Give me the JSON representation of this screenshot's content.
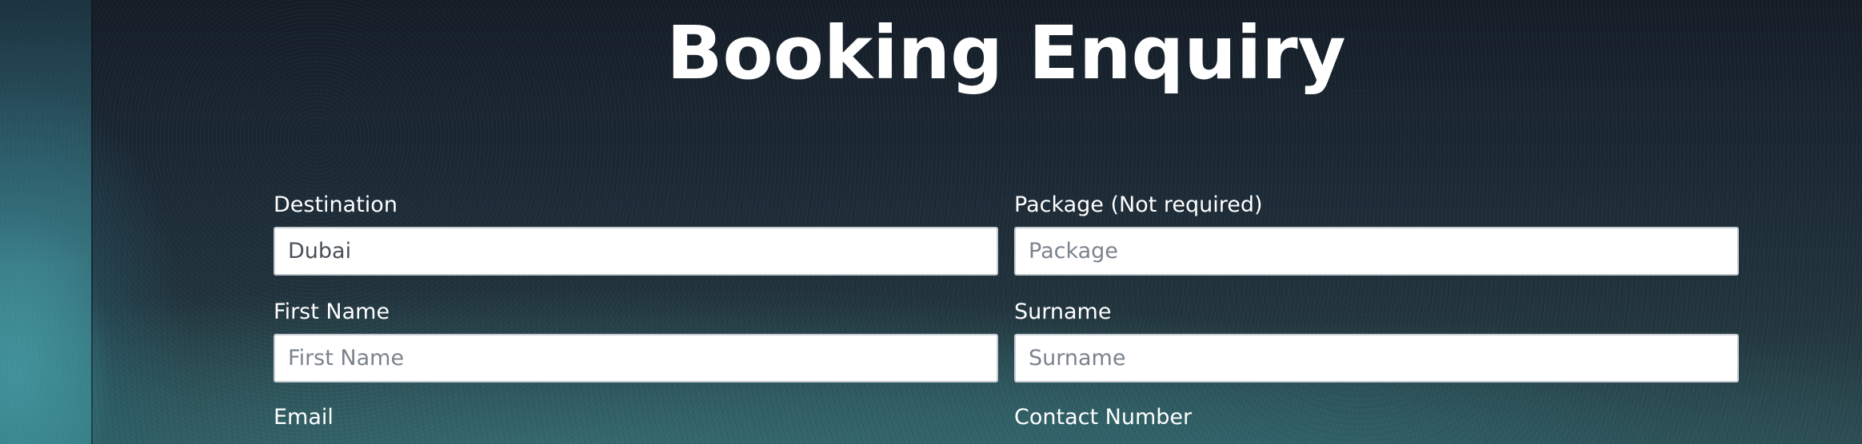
{
  "page": {
    "title": "Booking Enquiry"
  },
  "form": {
    "destination": {
      "label": "Destination",
      "value": "Dubai",
      "placeholder": ""
    },
    "package": {
      "label": "Package (Not required)",
      "value": "",
      "placeholder": "Package"
    },
    "first_name": {
      "label": "First Name",
      "value": "",
      "placeholder": "First Name"
    },
    "surname": {
      "label": "Surname",
      "value": "",
      "placeholder": "Surname"
    },
    "email": {
      "label": "Email"
    },
    "contact_number": {
      "label": "Contact Number"
    }
  },
  "colors": {
    "title_text": "#ffffff",
    "label_text": "#ffffff",
    "input_background": "#ffffff",
    "input_border": "#c7ccd3",
    "placeholder_text": "#7b838c"
  }
}
